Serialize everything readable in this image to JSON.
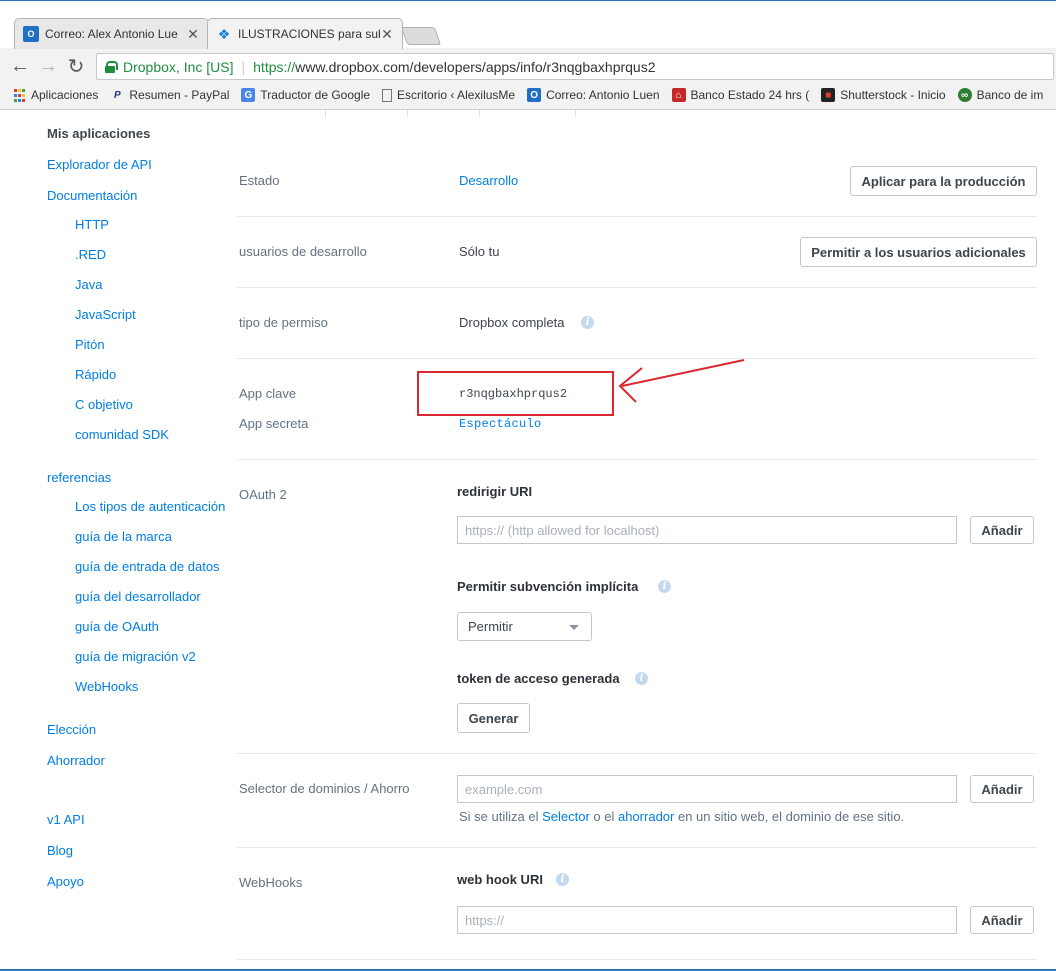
{
  "browser": {
    "tabs": [
      {
        "title": "Correo: Alex Antonio Lue",
        "icon": "outlook-icon"
      },
      {
        "title": "ILUSTRACIONES para sub",
        "icon": "dropbox-icon"
      }
    ],
    "secure_label": "Dropbox, Inc [US]",
    "url_scheme": "https://",
    "url_rest": "www.dropbox.com/developers/apps/info/r3nqgbaxhprqus2",
    "bookmarks": [
      {
        "label": "Aplicaciones",
        "icon": "apps-grid-icon"
      },
      {
        "label": "Resumen - PayPal",
        "icon": "paypal-icon"
      },
      {
        "label": "Traductor de Google",
        "icon": "google-translate-icon"
      },
      {
        "label": "Escritorio ‹ AlexilusMe",
        "icon": "page-icon"
      },
      {
        "label": "Correo: Antonio Luen",
        "icon": "outlook-icon"
      },
      {
        "label": "Banco Estado 24 hrs (",
        "icon": "bank-icon"
      },
      {
        "label": "Shutterstock - Inicio",
        "icon": "shutterstock-icon"
      },
      {
        "label": "Banco de im",
        "icon": "bank-images-icon"
      }
    ]
  },
  "sidebar": {
    "items": [
      {
        "label": "Mis aplicaciones"
      },
      {
        "label": "Explorador de API"
      },
      {
        "label": "Documentación"
      },
      {
        "label": "HTTP"
      },
      {
        "label": ".RED"
      },
      {
        "label": "Java"
      },
      {
        "label": "JavaScript"
      },
      {
        "label": "Pitón"
      },
      {
        "label": "Rápido"
      },
      {
        "label": "C objetivo"
      },
      {
        "label": "comunidad SDK"
      },
      {
        "label": "referencias"
      },
      {
        "label": "Los tipos de autenticación"
      },
      {
        "label": "guía de la marca"
      },
      {
        "label": "guía de entrada de datos"
      },
      {
        "label": "guía del desarrollador"
      },
      {
        "label": "guía de OAuth"
      },
      {
        "label": "guía de migración v2"
      },
      {
        "label": "WebHooks"
      },
      {
        "label": "Elección"
      },
      {
        "label": "Ahorrador"
      },
      {
        "label": "v1 API"
      },
      {
        "label": "Blog"
      },
      {
        "label": "Apoyo"
      }
    ]
  },
  "settings": {
    "status_label": "Estado",
    "status_value": "Desarrollo",
    "apply_prod_button": "Aplicar para la producción",
    "dev_users_label": "usuarios de desarrollo",
    "dev_users_value": "Sólo tu",
    "allow_users_button": "Permitir a los usuarios adicionales",
    "permission_label": "tipo de permiso",
    "permission_value": "Dropbox completa",
    "app_key_label": "App clave",
    "app_key_value": "r3nqgbaxhprqus2",
    "app_secret_label": "App secreta",
    "app_secret_value": "Espectáculo",
    "oauth_label": "OAuth 2",
    "redirect_title": "redirigir URI",
    "redirect_placeholder": "https:// (http allowed for localhost)",
    "add_button": "Añadir",
    "implicit_title": "Permitir subvención implícita",
    "implicit_value": "Permitir",
    "token_title": "token de acceso generada",
    "generate_button": "Generar",
    "domains_label": "Selector de dominios / Ahorro",
    "domains_placeholder": "example.com",
    "domains_help_1": "Si se utiliza el ",
    "domains_help_link1": "Selector",
    "domains_help_2": " o el ",
    "domains_help_link2": "ahorrador",
    "domains_help_3": " en un sitio web, el dominio de ese sitio.",
    "webhooks_label": "WebHooks",
    "webhook_title": "web hook URI",
    "webhook_placeholder": "https://"
  },
  "colors": {
    "link": "#007ee5",
    "annotation": "#d9282f"
  }
}
